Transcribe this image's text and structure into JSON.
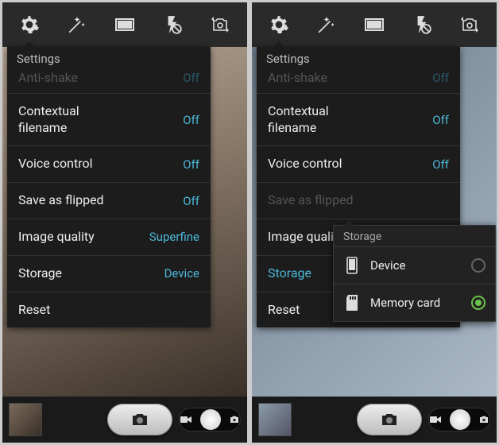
{
  "left": {
    "panel_title": "Settings",
    "rows": [
      {
        "label": "Anti-shake",
        "value": "Off",
        "dim": true
      },
      {
        "label": "Contextual filename",
        "value": "Off"
      },
      {
        "label": "Voice control",
        "value": "Off"
      },
      {
        "label": "Save as flipped",
        "value": "Off"
      },
      {
        "label": "Image quality",
        "value": "Superfine"
      },
      {
        "label": "Storage",
        "value": "Device"
      },
      {
        "label": "Reset",
        "value": ""
      }
    ]
  },
  "right": {
    "panel_title": "Settings",
    "rows": [
      {
        "label": "Anti-shake",
        "value": "Off",
        "dim": true
      },
      {
        "label": "Contextual filename",
        "value": "Off"
      },
      {
        "label": "Voice control",
        "value": "Off"
      },
      {
        "label": "Save as flipped",
        "value": "",
        "dimlabel": true
      },
      {
        "label": "Image quality",
        "value": ""
      },
      {
        "label": "Storage",
        "value": "",
        "link": true
      },
      {
        "label": "Reset",
        "value": ""
      }
    ],
    "storage_popup": {
      "title": "Storage",
      "options": [
        {
          "label": "Device",
          "selected": false
        },
        {
          "label": "Memory card",
          "selected": true
        }
      ]
    }
  }
}
